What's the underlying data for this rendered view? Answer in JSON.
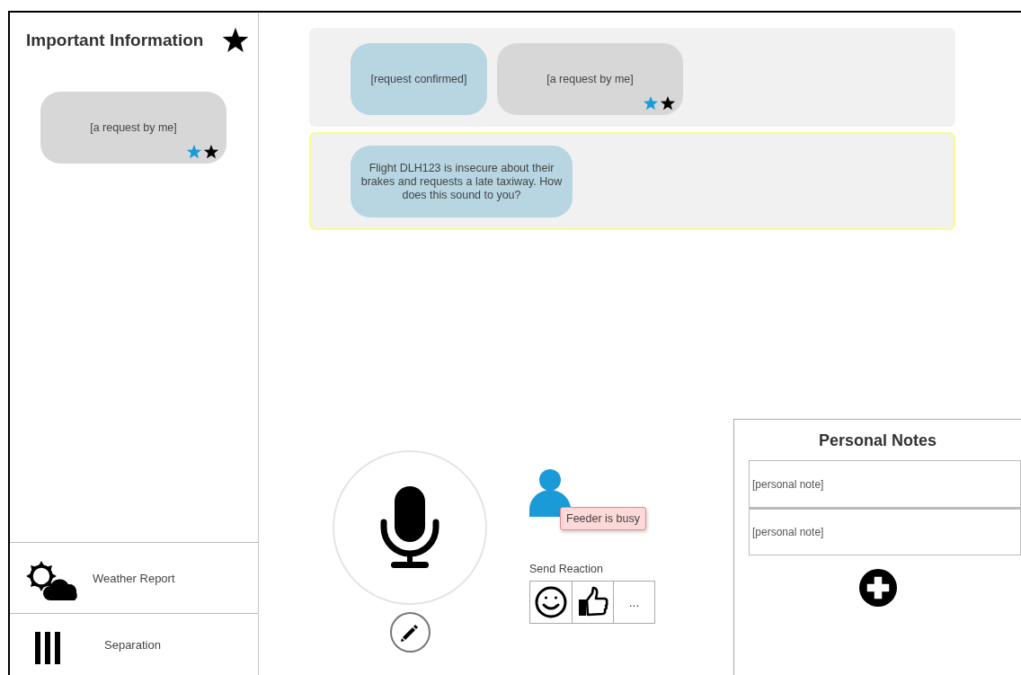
{
  "sidebar": {
    "title": "Important Information",
    "pinned": [
      {
        "kind": "own",
        "text": "[a request by me]",
        "flags": [
          {
            "color": "#1a9bd7"
          },
          {
            "color": "#000000"
          }
        ]
      }
    ],
    "items": [
      {
        "kind": "weather",
        "label": "Weather Report"
      },
      {
        "kind": "separation",
        "label": "Separation"
      }
    ]
  },
  "conversation": [
    {
      "highlighted": false,
      "messages": [
        {
          "kind": "confirmed",
          "text": "[request confirmed]"
        },
        {
          "kind": "own",
          "text": "[a request by me]",
          "flags": [
            {
              "color": "#1a9bd7"
            },
            {
              "color": "#000000"
            }
          ]
        }
      ]
    },
    {
      "highlighted": true,
      "messages": [
        {
          "kind": "confirmed",
          "text": "Flight DLH123 is insecure about their brakes and requests a late taxiway. How does this sound to you?"
        }
      ]
    }
  ],
  "feeder": {
    "status": "Feeder is busy"
  },
  "reactions": {
    "label": "Send Reaction",
    "buttons": [
      {
        "kind": "smile"
      },
      {
        "kind": "thumbs-up"
      },
      {
        "kind": "more",
        "text": "..."
      }
    ]
  },
  "notes": {
    "title": "Personal Notes",
    "items": [
      {
        "placeholder": "[personal note]"
      },
      {
        "placeholder": "[personal note]"
      }
    ]
  }
}
